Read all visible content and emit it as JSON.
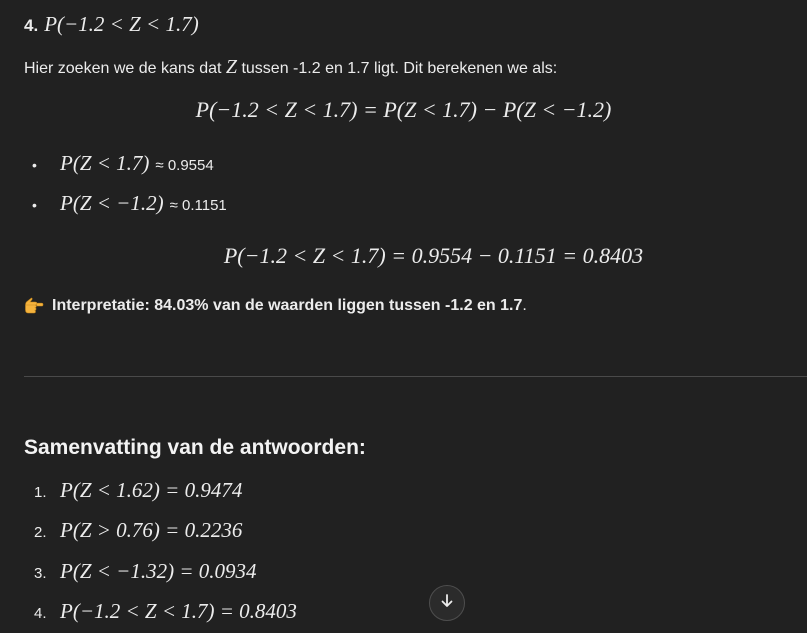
{
  "section4": {
    "number": "4.",
    "title_math": "P(−1.2 < Z < 1.7)"
  },
  "intro": {
    "before": "Hier zoeken we de kans dat ",
    "var": "Z",
    "after": " tussen -1.2 en 1.7 ligt. Dit berekenen we als:"
  },
  "formula_main": "P(−1.2 < Z < 1.7) = P(Z < 1.7) − P(Z < −1.2)",
  "bullets": [
    {
      "math": "P(Z < 1.7)",
      "approx": "≈ 0.9554"
    },
    {
      "math": "P(Z < −1.2)",
      "approx": "≈ 0.1151"
    }
  ],
  "formula_result": "P(−1.2 < Z < 1.7) = 0.9554 − 0.1151 = 0.8403",
  "interpretation": {
    "icon": "pointing-hand-icon",
    "label": "Interpretatie:",
    "text": " 84.03% van de waarden liggen tussen -1.2 en 1.7",
    "end": "."
  },
  "summary": {
    "title": "Samenvatting van de antwoorden:",
    "items": [
      {
        "n": "1.",
        "math": "P(Z < 1.62) = 0.9474"
      },
      {
        "n": "2.",
        "math": "P(Z > 0.76) = 0.2236"
      },
      {
        "n": "3.",
        "math": "P(Z < −1.32) = 0.0934"
      },
      {
        "n": "4.",
        "math": "P(−1.2 < Z < 1.7) = 0.8403"
      }
    ]
  },
  "scroll_button": {
    "icon": "arrow-down-icon"
  },
  "colors": {
    "background": "#212121",
    "text": "#ececec",
    "divider": "#4a4a4a",
    "hand": "#f5b33d"
  }
}
